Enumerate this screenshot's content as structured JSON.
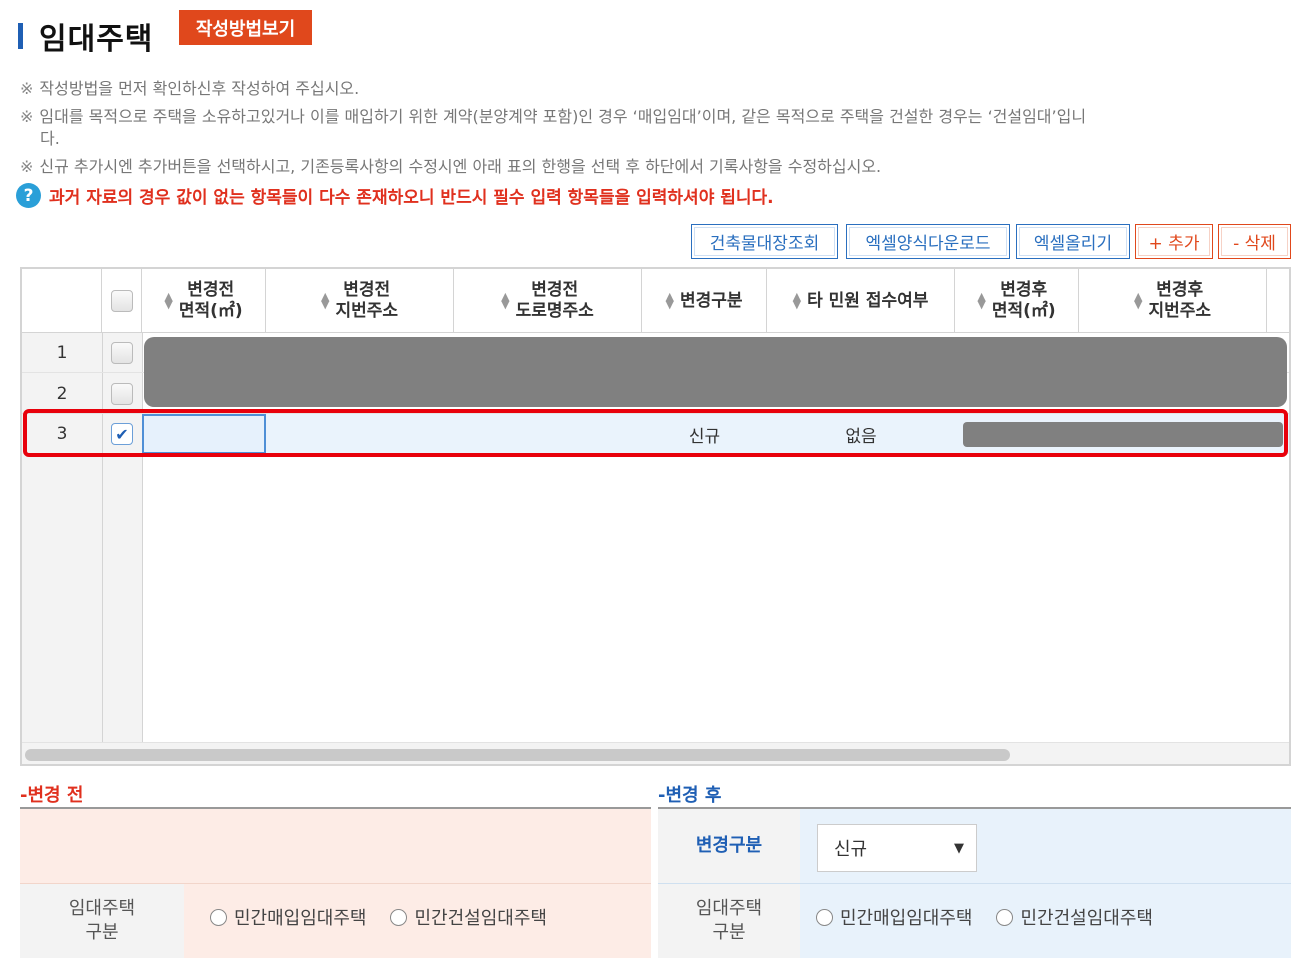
{
  "header": {
    "title": "임대주택",
    "guide_button": "작성방법보기"
  },
  "notices": {
    "mark": "※",
    "line1": "작성방법을 먼저 확인하신후 작성하여 주십시오.",
    "line2": "임대를 목적으로 주택을 소유하고있거나 이를 매입하기 위한 계약(분양계약 포함)인 경우 ‘매입임대’이며, 같은 목적으로 주택을 건설한 경우는 ‘건설임대’입니",
    "line2b": "다.",
    "line3": "신규 추가시엔 추가버튼을 선택하시고, 기존등록사항의 수정시엔 아래 표의 한행을 선택 후 하단에서 기록사항을 수정하십시오.",
    "warning": "과거 자료의 경우 값이 없는 항목들이 다수 존재하오니 반드시 필수 입력 항목들을 입력하셔야 됩니다."
  },
  "toolbar": {
    "building_ledger": "건축물대장조회",
    "excel_download": "엑셀양식다운로드",
    "excel_upload": "엑셀올리기",
    "add": "+ 추가",
    "delete": "- 삭제"
  },
  "grid": {
    "columns": [
      {
        "line1": "변경전",
        "line2": "면적(㎡)"
      },
      {
        "line1": "변경전",
        "line2": "지번주소"
      },
      {
        "line1": "변경전",
        "line2": "도로명주소"
      },
      {
        "line1": "변경구분",
        "line2": ""
      },
      {
        "line1": "타 민원 접수여부",
        "line2": ""
      },
      {
        "line1": "변경후",
        "line2": "면적(㎡)"
      },
      {
        "line1": "변경후",
        "line2": "지번주소"
      }
    ],
    "rows": [
      {
        "num": "1",
        "checked": false
      },
      {
        "num": "2",
        "checked": false
      },
      {
        "num": "3",
        "checked": true,
        "change_type": "신규",
        "other_petition": "없음"
      }
    ]
  },
  "before": {
    "label": "-변경 전",
    "rental_type_label_1": "임대주택",
    "rental_type_label_2": "구분",
    "option_purchase": "민간매입임대주택",
    "option_construct": "민간건설임대주택"
  },
  "after": {
    "label": "-변경 후",
    "change_type_label": "변경구분",
    "change_type_value": "신규",
    "rental_type_label_1": "임대주택",
    "rental_type_label_2": "구분",
    "option_purchase": "민간매입임대주택",
    "option_construct": "민간건설임대주택"
  },
  "colors": {
    "accent_blue": "#1f5fb4",
    "accent_red": "#e0481c",
    "highlight_red": "#e8000b",
    "before_bg": "#fdece6",
    "after_bg": "#e8f2fb"
  }
}
